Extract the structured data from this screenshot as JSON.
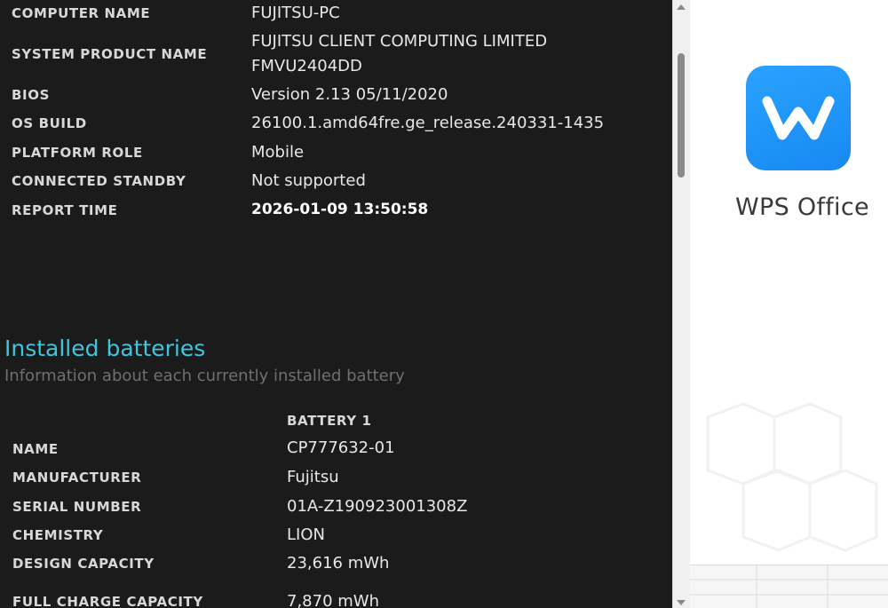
{
  "system_info": {
    "rows": [
      {
        "label": "COMPUTER NAME",
        "value": "FUJITSU-PC"
      },
      {
        "label": "SYSTEM PRODUCT NAME",
        "value": "FUJITSU CLIENT COMPUTING LIMITED",
        "value2": "FMVU2404DD"
      },
      {
        "label": "BIOS",
        "value": "Version 2.13 05/11/2020"
      },
      {
        "label": "OS BUILD",
        "value": "26100.1.amd64fre.ge_release.240331-1435"
      },
      {
        "label": "PLATFORM ROLE",
        "value": "Mobile"
      },
      {
        "label": "CONNECTED STANDBY",
        "value": "Not supported"
      },
      {
        "label": "REPORT TIME",
        "value": "2026-01-09  13:50:58"
      }
    ]
  },
  "batteries": {
    "title": "Installed batteries",
    "subtitle": "Information about each currently installed battery",
    "column_header": "BATTERY 1",
    "rows": [
      {
        "label": "NAME",
        "value": "CP777632-01"
      },
      {
        "label": "MANUFACTURER",
        "value": "Fujitsu"
      },
      {
        "label": "SERIAL NUMBER",
        "value": "01A-Z190923001308Z"
      },
      {
        "label": "CHEMISTRY",
        "value": "LION"
      },
      {
        "label": "DESIGN CAPACITY",
        "value": "23,616 mWh"
      },
      {
        "label": "FULL CHARGE CAPACITY",
        "value": "7,870 mWh"
      }
    ]
  },
  "wps": {
    "app_name": "WPS Office",
    "icon": "wps-logo-icon",
    "brand_color": "#1a8cf5"
  },
  "colors": {
    "section_title": "#3ec6de",
    "background": "#1b1b1b"
  }
}
